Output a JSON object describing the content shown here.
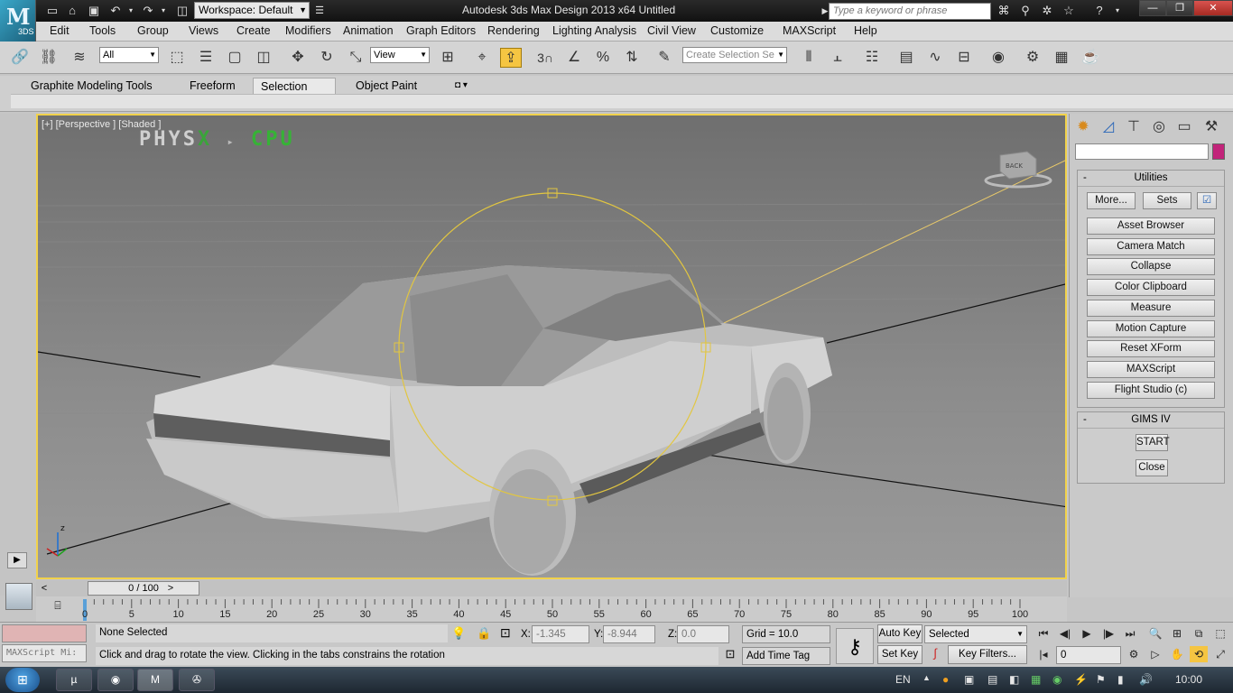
{
  "titlebar": {
    "workspace": "Workspace: Default",
    "title": "Autodesk 3ds Max Design 2013 x64      Untitled",
    "search_placeholder": "Type a keyword or phrase",
    "logo_text": "3DS"
  },
  "menu": [
    "Edit",
    "Tools",
    "Group",
    "Views",
    "Create",
    "Modifiers",
    "Animation",
    "Graph Editors",
    "Rendering",
    "Lighting Analysis",
    "Civil View",
    "Customize",
    "MAXScript",
    "Help"
  ],
  "toolbar": {
    "filter": "All",
    "ref_coord": "View",
    "selection_set_placeholder": "Create Selection Se",
    "snap_label": "3"
  },
  "ribbon": {
    "tabs": [
      "Graphite Modeling Tools",
      "Freeform",
      "Selection",
      "Object Paint"
    ],
    "active_tab": "Selection"
  },
  "viewport": {
    "label": "[+] [Perspective ] [Shaded ]",
    "physx_a": "PHYS",
    "physx_x": "X",
    "physx_cpu": "CPU",
    "viewcube_text": "BACK",
    "axis_z": "z"
  },
  "command_panel": {
    "utilities_title": "Utilities",
    "more_label": "More...",
    "sets_label": "Sets",
    "utility_buttons": [
      "Asset Browser",
      "Camera Match",
      "Collapse",
      "Color Clipboard",
      "Measure",
      "Motion Capture",
      "Reset XForm",
      "MAXScript",
      "Flight Studio (c)"
    ],
    "gims_title": "GIMS IV",
    "start_label": "START",
    "close_label": "Close",
    "name_color": "#c2247a"
  },
  "timeline": {
    "frame": "0 / 100",
    "ticks": [
      "0",
      "5",
      "10",
      "15",
      "20",
      "25",
      "30",
      "35",
      "40",
      "45",
      "50",
      "55",
      "60",
      "65",
      "70",
      "75",
      "80",
      "85",
      "90",
      "95",
      "100"
    ]
  },
  "status": {
    "maxscript_mini": "MAXScript Mi:",
    "selection": "None Selected",
    "prompt": "Click and drag to rotate the view.  Clicking in the tabs constrains the rotation",
    "x_label": "X:",
    "x_value": "-1.345",
    "y_label": "Y:",
    "y_value": "-8.944",
    "z_label": "Z:",
    "z_value": "0.0",
    "grid": "Grid = 10.0",
    "add_time_tag": "Add Time Tag",
    "auto_key": "Auto Key",
    "set_key": "Set Key",
    "key_mode": "Selected",
    "key_filters": "Key Filters...",
    "frame_value": "0"
  },
  "taskbar": {
    "language": "EN",
    "clock": "10:00"
  }
}
